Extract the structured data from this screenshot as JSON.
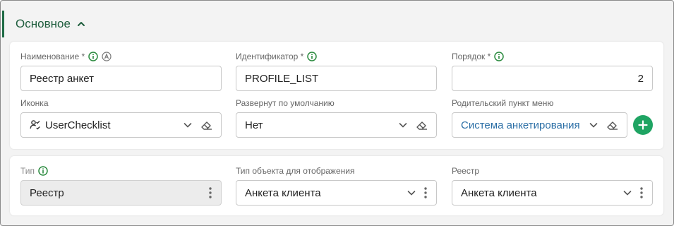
{
  "section": {
    "title": "Основное"
  },
  "main": {
    "name": {
      "label": "Наименование *",
      "value": "Реестр анкет"
    },
    "identifier": {
      "label": "Идентификатор *",
      "value": "PROFILE_LIST"
    },
    "order": {
      "label": "Порядок *",
      "value": "2"
    },
    "icon": {
      "label": "Иконка",
      "value": "UserChecklist",
      "icon_name": "user-checklist-icon"
    },
    "expanded": {
      "label": "Развернут по умолчанию",
      "value": "Нет"
    },
    "parent": {
      "label": "Родительский пункт меню",
      "value": "Система анкетирования"
    }
  },
  "type_block": {
    "type": {
      "label": "Тип",
      "value": "Реестр"
    },
    "object_type": {
      "label": "Тип объекта для отображения",
      "value": "Анкета клиента"
    },
    "registry": {
      "label": "Реестр",
      "value": "Анкета клиента"
    }
  },
  "colors": {
    "accent": "#1f6b45",
    "info": "#2a8a3e",
    "add": "#1fa463",
    "link": "#2c6fa6"
  }
}
